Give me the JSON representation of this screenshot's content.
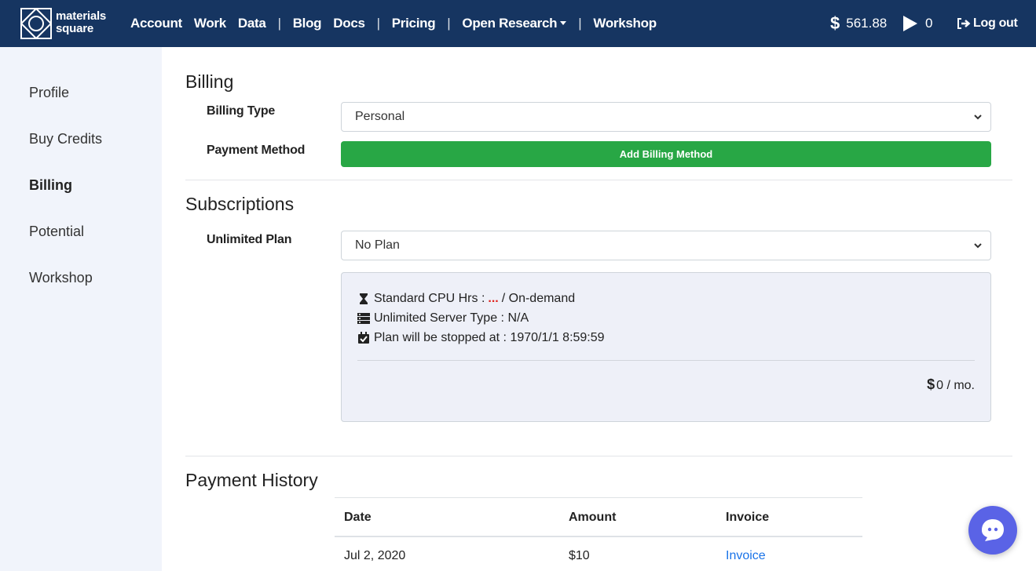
{
  "header": {
    "logo_text_line1": "materials",
    "logo_text_line2": "square",
    "nav": [
      "Account",
      "Work",
      "Data",
      "Blog",
      "Docs",
      "Pricing",
      "Open Research",
      "Workshop"
    ],
    "separator": "|",
    "credits": "561.88",
    "runs": "0",
    "logout": "Log out"
  },
  "sidebar": {
    "items": [
      {
        "label": "Profile",
        "active": false
      },
      {
        "label": "Buy Credits",
        "active": false
      },
      {
        "label": "Billing",
        "active": true
      },
      {
        "label": "Potential",
        "active": false
      },
      {
        "label": "Workshop",
        "active": false
      }
    ]
  },
  "billing": {
    "title": "Billing",
    "type_label": "Billing Type",
    "type_value": "Personal",
    "payment_label": "Payment Method",
    "payment_button": "Add Billing Method"
  },
  "subscriptions": {
    "title": "Subscriptions",
    "plan_label": "Unlimited Plan",
    "plan_value": "No Plan",
    "cpu_prefix": "Standard CPU Hrs :",
    "cpu_value": "...",
    "cpu_suffix": "/ On-demand",
    "server_type": "Unlimited Server Type : N/A",
    "stop_date": "Plan will be stopped at : 1970/1/1 8:59:59",
    "price": "0 / mo."
  },
  "history": {
    "title": "Payment History",
    "columns": [
      "Date",
      "Amount",
      "Invoice"
    ],
    "rows": [
      {
        "date": "Jul 2, 2020",
        "amount": "$10",
        "invoice": "Invoice"
      }
    ]
  },
  "colors": {
    "header_bg": "#163561",
    "sidebar_bg": "#f1f4fb",
    "button_green": "#28a745",
    "link_blue": "#1a73e8",
    "chat_purple": "#5a63e6",
    "accent_red": "#e0231d"
  },
  "icons": [
    "logo-icon",
    "dollar-icon",
    "play-icon",
    "logout-icon",
    "chevron-down-icon",
    "hourglass-icon",
    "server-icon",
    "calendar-check-icon",
    "chat-icon"
  ]
}
